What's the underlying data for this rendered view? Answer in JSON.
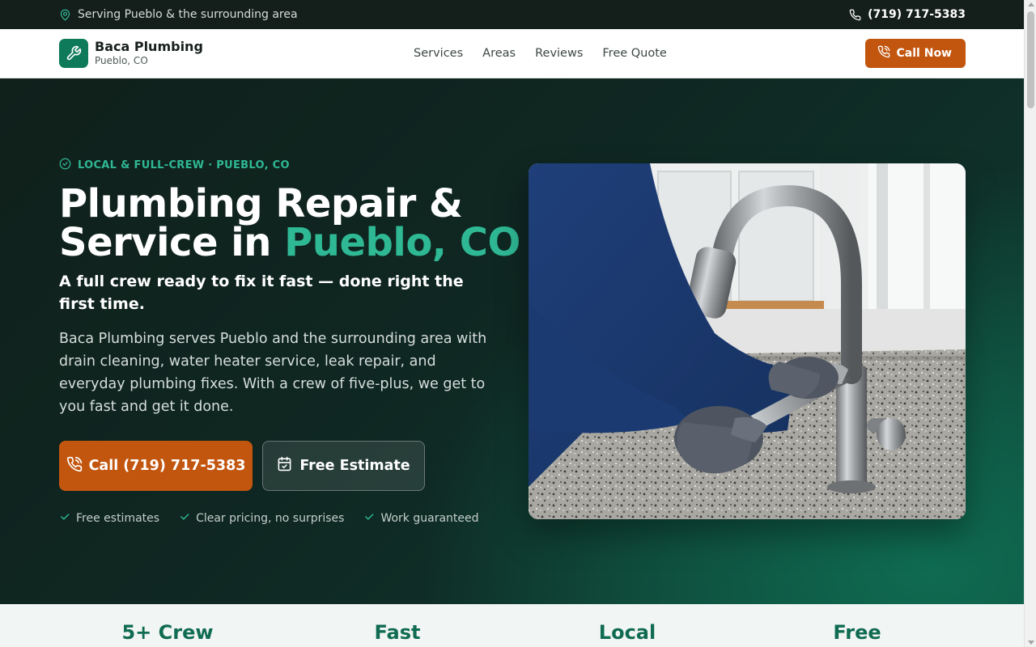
{
  "topbar": {
    "location_text": "Serving Pueblo & the surrounding area",
    "phone": "(719) 717-5383"
  },
  "nav": {
    "brand_name": "Baca Plumbing",
    "brand_location": "Pueblo, CO",
    "links": [
      "Services",
      "Areas",
      "Reviews",
      "Free Quote"
    ],
    "cta_label": "Call Now"
  },
  "hero": {
    "eyebrow": "LOCAL & FULL-CREW · PUEBLO, CO",
    "title_line1": "Plumbing Repair &",
    "title_line2_prefix": "Service in ",
    "title_line2_accent": "Pueblo, CO",
    "subtitle": "A full crew ready to fix it fast — done right the first time.",
    "description": "Baca Plumbing serves Pueblo and the surrounding area with drain cleaning, water heater service, leak repair, and everyday plumbing fixes. With a crew of five-plus, we get to you fast and get it done.",
    "primary_button": "Call (719) 717-5383",
    "secondary_button": "Free Estimate",
    "checks": [
      "Free estimates",
      "Clear pricing, no surprises",
      "Work guaranteed"
    ]
  },
  "stats": [
    "5+ Crew",
    "Fast",
    "Local",
    "Free"
  ],
  "colors": {
    "accent_green": "#2fb894",
    "brand_green": "#0f7a5a",
    "cta_orange": "#c2560f",
    "hero_dark": "#10201b"
  },
  "icons": {
    "topbar_location": "map-pin-icon",
    "topbar_phone": "phone-icon",
    "brand": "wrench-icon",
    "nav_cta": "phone-call-icon",
    "eyebrow": "check-circle-icon",
    "secondary_button": "calendar-check-icon",
    "checks": "check-icon"
  }
}
